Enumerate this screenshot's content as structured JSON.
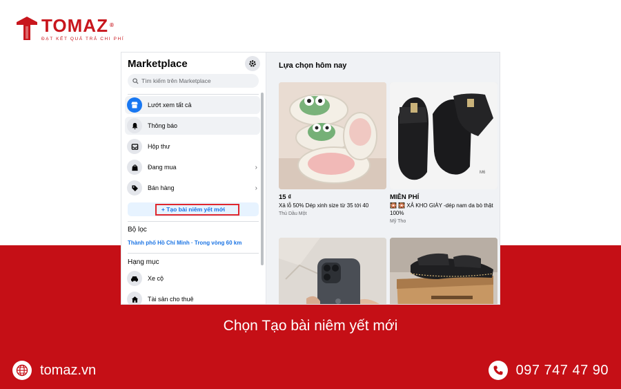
{
  "brand": {
    "name": "TOMAZ",
    "registered": "®",
    "tagline": "ĐẠT KẾT QUẢ TRẢ CHI PHÍ",
    "color": "#c8161d"
  },
  "caption": "Chọn Tạo bài niêm yết mới",
  "footer": {
    "website": "tomaz.vn",
    "website_icon": "globe-icon",
    "phone": "097 747 47 90",
    "phone_icon": "phone-icon",
    "band_color": "#c50f16"
  },
  "marketplace": {
    "title": "Marketplace",
    "settings_icon": "gear-icon",
    "search": {
      "placeholder": "Tìm kiếm trên Marketplace",
      "icon": "search-icon"
    },
    "nav": [
      {
        "label": "Lướt xem tất cả",
        "icon": "store-icon",
        "active": true
      },
      {
        "label": "Thông báo",
        "icon": "bell-icon"
      },
      {
        "label": "Hộp thư",
        "icon": "inbox-icon"
      },
      {
        "label": "Đang mua",
        "icon": "bag-icon",
        "has_chevron": true
      },
      {
        "label": "Bán hàng",
        "icon": "tag-icon",
        "has_chevron": true
      }
    ],
    "create_button": "+ Tạo bài niêm yết mới",
    "filter": {
      "title": "Bộ lọc",
      "value": "Thành phố Hồ Chí Minh · Trong vòng 60 km"
    },
    "categories": {
      "title": "Hạng mục",
      "items": [
        {
          "label": "Xe cộ",
          "icon": "car-icon"
        },
        {
          "label": "Tài sản cho thuê",
          "icon": "home-icon"
        }
      ]
    },
    "feed_title": "Lựa chọn hôm nay",
    "listings": [
      {
        "price": "15 ₫",
        "title": "Xả lỗ 50% Dép xinh size từ 35 tới 40",
        "location": "Thủ Dầu Một"
      },
      {
        "price": "MIỄN PHÍ",
        "title": "🎇 🎇 XẢ KHO GIÀY -dép nam da bò thật 100%",
        "location": "Mỹ Tho"
      },
      {
        "price": "",
        "title": "",
        "location": ""
      },
      {
        "price": "",
        "title": "",
        "location": ""
      }
    ]
  }
}
